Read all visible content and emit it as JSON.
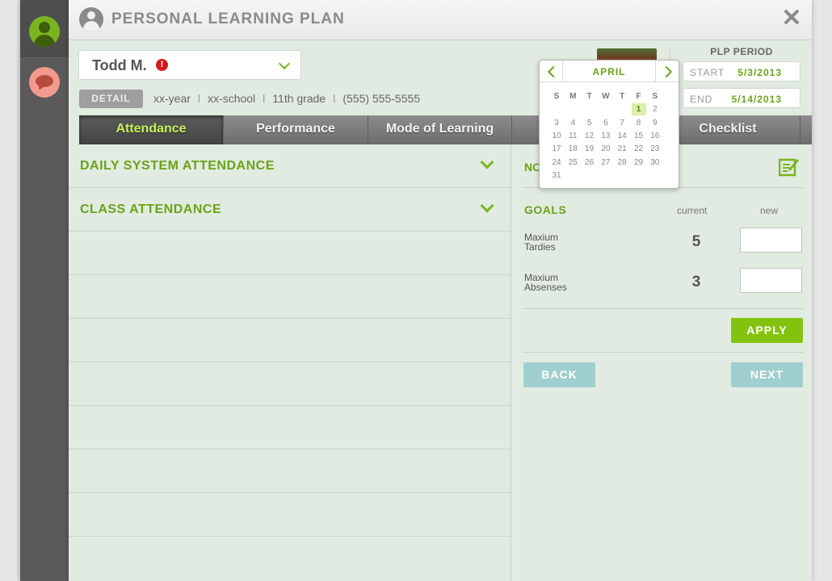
{
  "app": {
    "title": "PERSONAL LEARNING PLAN",
    "close_label": "✕"
  },
  "student": {
    "name": "Todd M.",
    "alert": "!",
    "detail_label": "DETAIL",
    "year": "xx-year",
    "school": "xx-school",
    "grade": "11th grade",
    "phone": "(555) 555-5555",
    "separator": "l"
  },
  "plp": {
    "label": "PLP PERIOD",
    "start_label": "START",
    "start_value": "5/3/2013",
    "end_label": "END",
    "end_value": "5/14/2013"
  },
  "tabs": [
    {
      "label": "Attendance",
      "active": true
    },
    {
      "label": "Performance",
      "active": false
    },
    {
      "label": "Mode of Learning",
      "active": false
    },
    {
      "label": "",
      "active": false
    },
    {
      "label": "Checklist",
      "active": false
    }
  ],
  "sections": [
    {
      "title": "DAILY SYSTEM ATTENDANCE"
    },
    {
      "title": "CLASS ATTENDANCE"
    }
  ],
  "notes": {
    "label": "NO"
  },
  "goals": {
    "label": "GOALS",
    "col_current": "current",
    "col_new": "new",
    "items": [
      {
        "name": "Maxium Tardies",
        "current": "5",
        "new": ""
      },
      {
        "name": "Maxium Absenses",
        "current": "3",
        "new": ""
      }
    ],
    "apply_label": "APPLY"
  },
  "nav": {
    "back_label": "BACK",
    "next_label": "NEXT"
  },
  "calendar": {
    "month": "APRIL",
    "weekdays": [
      "S",
      "M",
      "T",
      "W",
      "T",
      "F",
      "S"
    ],
    "selected_day": 1,
    "weeks": [
      [
        "",
        "",
        "",
        "",
        "",
        "1",
        "2"
      ],
      [
        "3",
        "4",
        "5",
        "6",
        "7",
        "8",
        "9"
      ],
      [
        "10",
        "11",
        "12",
        "13",
        "14",
        "15",
        "16"
      ],
      [
        "17",
        "18",
        "19",
        "20",
        "21",
        "22",
        "23"
      ],
      [
        "24",
        "25",
        "26",
        "27",
        "28",
        "29",
        "30"
      ],
      [
        "31",
        "",
        "",
        "",
        "",
        "",
        ""
      ]
    ]
  },
  "colors": {
    "accent": "#6aa319",
    "apply": "#83c30f",
    "nav_button": "#9fcfcf",
    "alert": "#d11b1b"
  },
  "icons": [
    "user-avatar-icon",
    "chat-icon",
    "user-icon",
    "close-icon",
    "alert-icon",
    "chevron-down-icon",
    "edit-note-icon",
    "chevron-left-icon",
    "chevron-right-icon"
  ]
}
